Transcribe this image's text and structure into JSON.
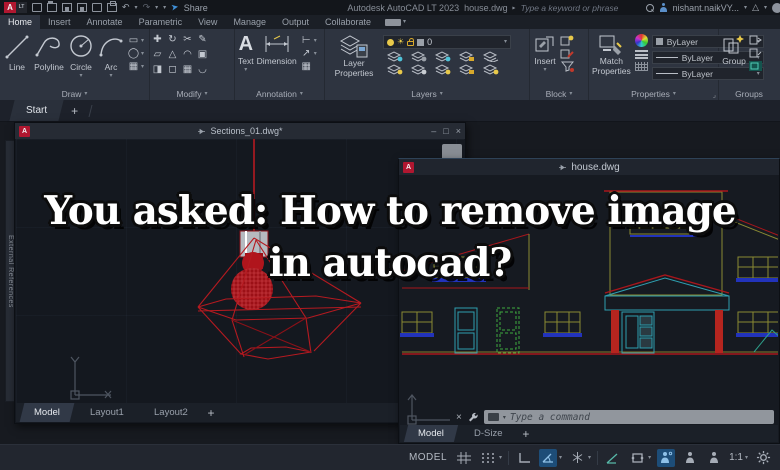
{
  "app": {
    "badge_letter": "A",
    "badge_lt": "LT"
  },
  "titlebar": {
    "share_label": "Share",
    "app_title": "Autodesk AutoCAD LT 2023",
    "doc_title": "house.dwg",
    "search_placeholder": "Type a keyword or phrase",
    "user_name": "nishant.naikVY...",
    "undo_glyph": "↶",
    "redo_glyph": "↷"
  },
  "ribbon": {
    "tabs": [
      "Home",
      "Insert",
      "Annotate",
      "Parametric",
      "View",
      "Manage",
      "Output",
      "Collaborate"
    ],
    "panels": {
      "draw": {
        "label": "Draw",
        "tools": [
          "Line",
          "Polyline",
          "Circle",
          "Arc"
        ]
      },
      "modify": {
        "label": "Modify"
      },
      "annotation": {
        "label": "Annotation",
        "big_a": "A",
        "text_tool": "Text",
        "dimension_tool": "Dimension"
      },
      "layers": {
        "label": "Layers",
        "big": "Layer Properties",
        "current_layer": "0"
      },
      "block": {
        "label": "Block",
        "big": "Insert"
      },
      "properties": {
        "label": "Properties",
        "big": "Match Properties",
        "color": "ByLayer",
        "linetype": "ByLayer",
        "lineweight": "ByLayer"
      },
      "groups": {
        "label": "Groups",
        "big": "Group"
      }
    }
  },
  "file_tabs": {
    "start": "Start",
    "new_tab": "+"
  },
  "xref_palette_label": "External References",
  "sections_window": {
    "title": "Sections_01.dwg*",
    "layout_tabs": [
      "Model",
      "Layout1",
      "Layout2"
    ],
    "new_tab": "+",
    "min": "–",
    "max": "□",
    "close": "×"
  },
  "house_window": {
    "title": "house.dwg",
    "command_placeholder": "Type a command",
    "close_cmd": "×",
    "layout_tabs": [
      "Model",
      "D-Size"
    ],
    "new_tab": "+"
  },
  "overlay": {
    "line1": "You asked: How to remove image",
    "line2": "in autocad?"
  },
  "statusbar": {
    "space_label": "MODEL",
    "annotation_scale": "1:1"
  },
  "colors": {
    "accent_red": "#b01730",
    "active_blue": "#1d4d78",
    "cad_red": "#b5251f",
    "cad_yellow": "#8a8a33",
    "cad_cyan": "#2e9fb0",
    "cad_green": "#3faa3f",
    "cad_blue": "#2233bb",
    "canvas_bg": "#14181f"
  }
}
